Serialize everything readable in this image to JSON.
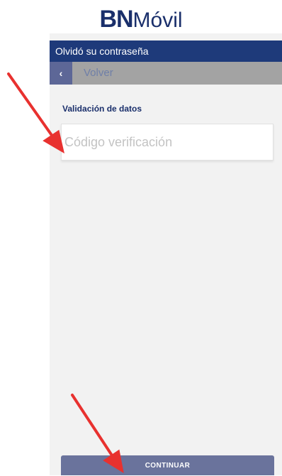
{
  "header": {
    "brand_bold": "BN",
    "brand_light": "Móvil"
  },
  "titlebar": {
    "title": "Olvidó su contraseña"
  },
  "nav": {
    "back_icon": "‹",
    "back_label": "Volver"
  },
  "form": {
    "section_label": "Validación de datos",
    "code_placeholder": "Código verificación",
    "code_value": ""
  },
  "actions": {
    "continue_label": "CONTINUAR"
  },
  "colors": {
    "brand_navy": "#1e3a7a",
    "subbar_gray": "#a3a3a3",
    "button": "#6a739c",
    "annotation_arrow": "#e8312f"
  }
}
